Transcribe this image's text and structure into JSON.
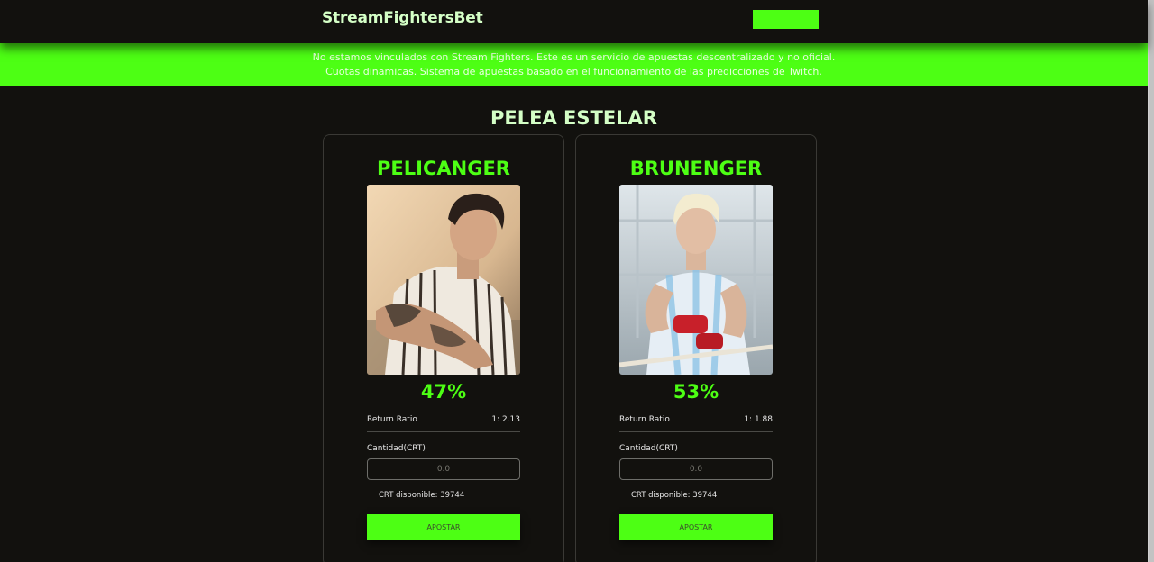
{
  "header": {
    "brand": "StreamFightersBet",
    "top_button_label": ""
  },
  "notice": {
    "line1": "No estamos vinculados con Stream Fighters. Este es un servicio de apuestas descentralizado y no oficial.",
    "line2": "Cuotas dinamicas. Sistema de apuestas basado en el funcionamiento de las predicciones de Twitch."
  },
  "main": {
    "title": "PELEA ESTELAR",
    "fighters": [
      {
        "name": "PELICANGER",
        "percent": "47%",
        "return_ratio_label": "Return Ratio",
        "return_ratio_value": "1: 2.13",
        "amount_label": "Cantidad(CRT)",
        "amount_placeholder": "0.0",
        "available_text": "CRT disponible: 39744",
        "bet_button_label": "APOSTAR"
      },
      {
        "name": "BRUNENGER",
        "percent": "53%",
        "return_ratio_label": "Return Ratio",
        "return_ratio_value": "1: 1.88",
        "amount_label": "Cantidad(CRT)",
        "amount_placeholder": "0.0",
        "available_text": "CRT disponible: 39744",
        "bet_button_label": "APOSTAR"
      }
    ]
  },
  "colors": {
    "accent": "#4dff14",
    "background": "#12110e",
    "brand_text": "#d4ffc6"
  }
}
